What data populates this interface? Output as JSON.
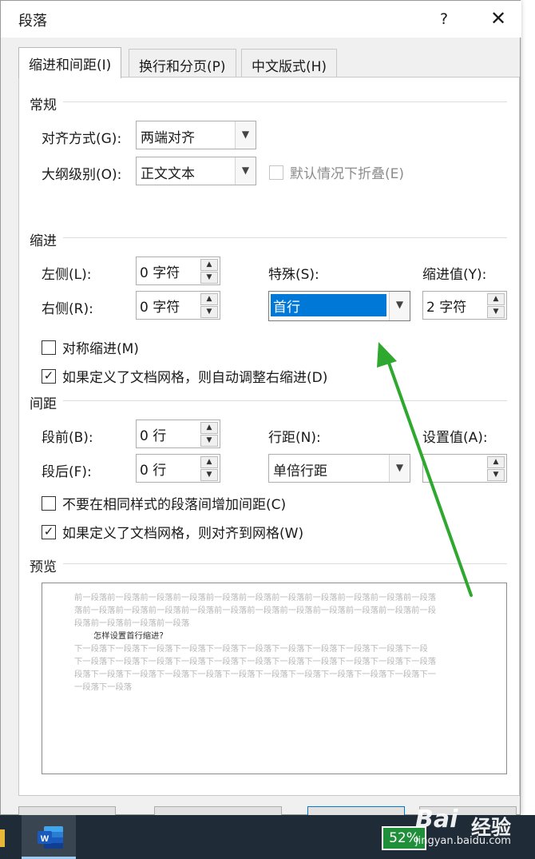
{
  "dialog": {
    "title": "段落",
    "help_label": "?",
    "close_label": "✕"
  },
  "tabs": [
    {
      "label": "缩进和间距(I)"
    },
    {
      "label": "换行和分页(P)"
    },
    {
      "label": "中文版式(H)"
    }
  ],
  "general": {
    "section": "常规",
    "alignment_label": "对齐方式(G):",
    "alignment_value": "两端对齐",
    "outline_label": "大纲级别(O):",
    "outline_value": "正文文本",
    "collapse_label": "默认情况下折叠(E)"
  },
  "indent": {
    "section": "缩进",
    "left_label": "左侧(L):",
    "left_value": "0 字符",
    "right_label": "右侧(R):",
    "right_value": "0 字符",
    "special_label": "特殊(S):",
    "special_value": "首行",
    "by_label": "缩进值(Y):",
    "by_value": "2 字符",
    "mirror_label": "对称缩进(M)",
    "auto_adjust_label": "如果定义了文档网格，则自动调整右缩进(D)"
  },
  "spacing": {
    "section": "间距",
    "before_label": "段前(B):",
    "before_value": "0 行",
    "after_label": "段后(F):",
    "after_value": "0 行",
    "line_label": "行距(N):",
    "line_value": "单倍行距",
    "at_label": "设置值(A):",
    "at_value": "",
    "no_space_label": "不要在相同样式的段落间增加间距(C)",
    "snap_grid_label": "如果定义了文档网格，则对齐到网格(W)"
  },
  "preview": {
    "section": "预览",
    "prev_lines": [
      "前一段落前一段落前一段落前一段落前一段落前一段落前一段落前一段落前一段落前一段落前一段落",
      "落前一段落前一段落前一段落前一段落前一段落前一段落前一段落前一段落前一段落前一段落前一段",
      "段落前一段落前一段落前一段落"
    ],
    "sample_text": "怎样设置首行缩进?",
    "next_lines": [
      "下一段落下一段落下一段落下一段落下一段落下一段落下一段落下一段落下一段落下一段落下一段",
      "下一段落下一段落下一段落下一段落下一段落下一段落下一段落下一段落下一段落下一段落下一段落",
      "段落下一段落下一段落下一段落下一段落下一段落下一段落下一段落下一段落下一段落下一段落下一",
      "一段落下一段落"
    ]
  },
  "taskbar": {
    "battery": "52%",
    "watermark": "Bai",
    "watermark_cn": "经验",
    "watermark_url": "jingyan.baidu.com"
  },
  "colors": {
    "selection": "#0078d7",
    "arrow": "#2ea82e",
    "taskbar": "#1f2b36"
  }
}
